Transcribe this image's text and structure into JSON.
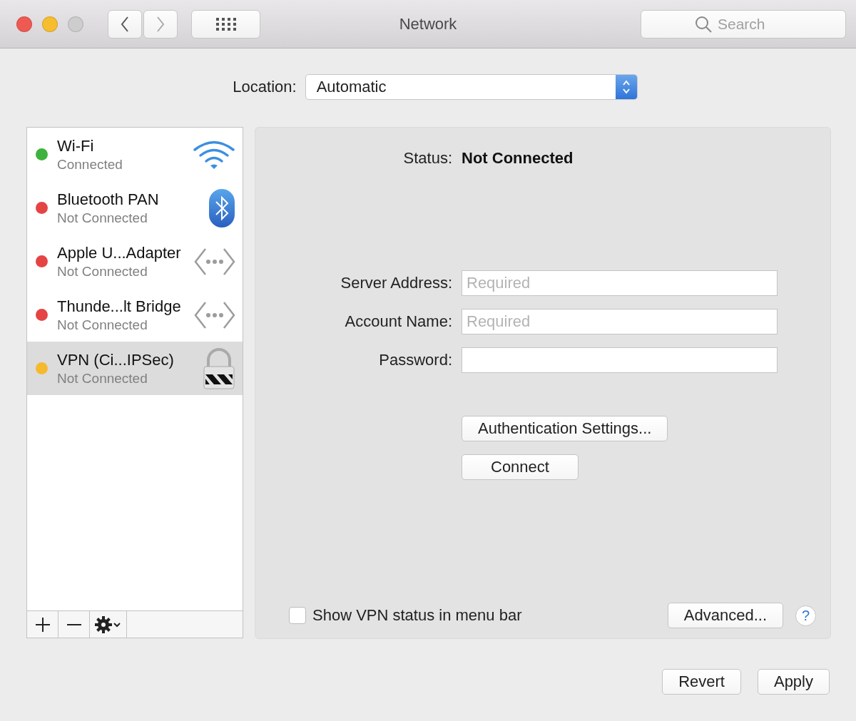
{
  "window": {
    "title": "Network"
  },
  "toolbar": {
    "search": {
      "placeholder": "Search"
    }
  },
  "location": {
    "label": "Location:",
    "value": "Automatic"
  },
  "services": [
    {
      "name": "Wi-Fi",
      "status": "Connected",
      "color": "#3db33d",
      "kind": "wifi",
      "selected": false
    },
    {
      "name": "Bluetooth PAN",
      "status": "Not Connected",
      "color": "#e54444",
      "kind": "bluetooth",
      "selected": false
    },
    {
      "name": "Apple U...Adapter",
      "status": "Not Connected",
      "color": "#e54444",
      "kind": "ethernet",
      "selected": false
    },
    {
      "name": "Thunde...lt Bridge",
      "status": "Not Connected",
      "color": "#e54444",
      "kind": "ethernet",
      "selected": false
    },
    {
      "name": "VPN (Ci...IPSec)",
      "status": "Not Connected",
      "color": "#f5b92e",
      "kind": "vpn",
      "selected": true
    }
  ],
  "detail": {
    "status_label": "Status:",
    "status_value": "Not Connected",
    "fields": [
      {
        "label": "Server Address:",
        "placeholder": "Required"
      },
      {
        "label": "Account Name:",
        "placeholder": "Required"
      },
      {
        "label": "Password:"
      }
    ],
    "buttons": [
      "Authentication Settings...",
      "Connect"
    ],
    "menu_bar_checkbox": {
      "label": "Show VPN status in menu bar",
      "checked": false
    },
    "advanced_button": "Advanced...",
    "help": "?"
  },
  "footer_buttons": [
    "Revert",
    "Apply"
  ]
}
